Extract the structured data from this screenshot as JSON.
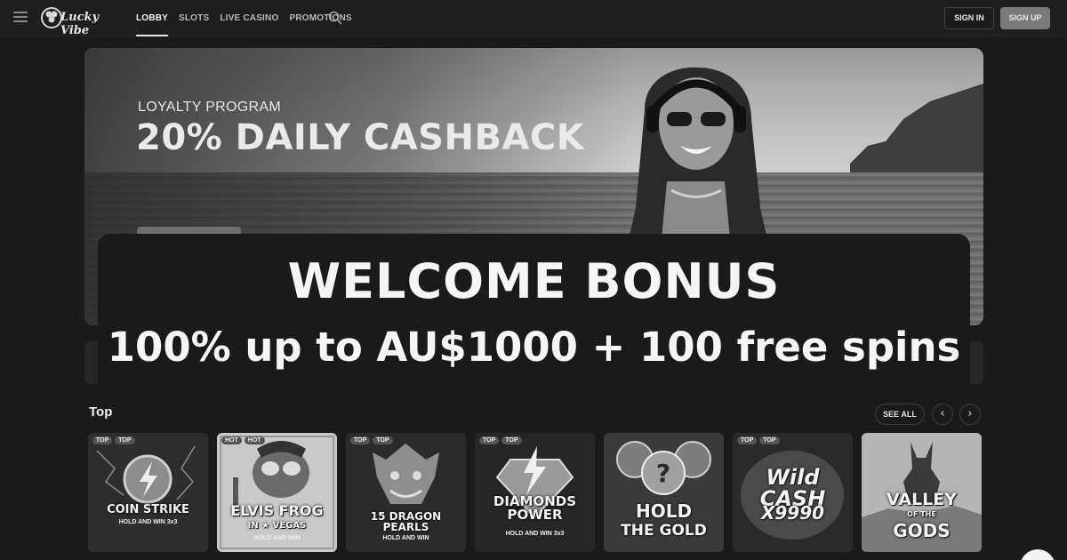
{
  "header": {
    "logo_text": "Lucky Vibe",
    "nav": [
      "LOBBY",
      "SLOTS",
      "LIVE CASINO",
      "PROMOTIONS"
    ],
    "active_nav": "LOBBY",
    "signin_label": "SIGN IN",
    "signup_label": "SIGN UP"
  },
  "hero": {
    "eyebrow": "LOYALTY PROGRAM",
    "title": "20% DAILY CASHBACK"
  },
  "overlay": {
    "title": "WELCOME BONUS",
    "subtitle": "100% up to AU$1000 + 100 free spins"
  },
  "section": {
    "title": "Top",
    "see_all": "SEE ALL",
    "prev": "‹",
    "next": "›"
  },
  "games": [
    {
      "badges": [
        "TOP",
        "TOP"
      ],
      "name": "COIN STRIKE",
      "sub": "HOLD AND WIN 3x3"
    },
    {
      "badges": [
        "HOT",
        "HOT"
      ],
      "name": "ELVIS FROG",
      "line2": "IN ★ VEGAS",
      "sub": "HOLD AND WIN"
    },
    {
      "badges": [
        "TOP",
        "TOP"
      ],
      "name": "15 DRAGON PEARLS",
      "sub": "HOLD AND WIN"
    },
    {
      "badges": [
        "TOP",
        "TOP"
      ],
      "name": "DIAMONDS POWER",
      "sub": "HOLD AND WIN 3x3"
    },
    {
      "badges": [],
      "name": "HOLD",
      "line2": "THE GOLD"
    },
    {
      "badges": [
        "TOP",
        "TOP"
      ],
      "name": "Wild CASH",
      "line2": "X9990"
    },
    {
      "badges": [],
      "name": "VALLEY",
      "small": "OF THE",
      "line2": "GODS"
    }
  ]
}
